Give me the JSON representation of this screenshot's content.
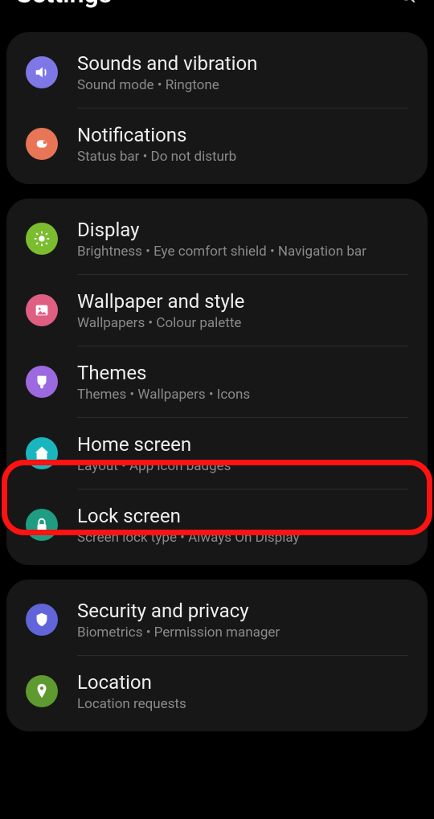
{
  "header": {
    "title": "Settings"
  },
  "groups": [
    {
      "items": [
        {
          "id": "sounds",
          "title": "Sounds and vibration",
          "subtitle": "Sound mode  •  Ringtone",
          "icon": "volume-icon",
          "color": "c-purple"
        },
        {
          "id": "notifications",
          "title": "Notifications",
          "subtitle": "Status bar  •  Do not disturb",
          "icon": "bell-icon",
          "color": "c-coral"
        }
      ]
    },
    {
      "items": [
        {
          "id": "display",
          "title": "Display",
          "subtitle": "Brightness  •  Eye comfort shield  •  Navigation bar",
          "icon": "sun-icon",
          "color": "c-green"
        },
        {
          "id": "wallpaper",
          "title": "Wallpaper and style",
          "subtitle": "Wallpapers  •  Colour palette",
          "icon": "picture-icon",
          "color": "c-pink"
        },
        {
          "id": "themes",
          "title": "Themes",
          "subtitle": "Themes  •  Wallpapers  •  Icons",
          "icon": "brush-icon",
          "color": "c-violet"
        },
        {
          "id": "home",
          "title": "Home screen",
          "subtitle": "Layout  •  App icon badges",
          "icon": "home-icon",
          "color": "c-teal"
        },
        {
          "id": "lock",
          "title": "Lock screen",
          "subtitle": "Screen lock type  •  Always On Display",
          "icon": "lock-icon",
          "color": "c-teal2"
        }
      ]
    },
    {
      "items": [
        {
          "id": "security",
          "title": "Security and privacy",
          "subtitle": "Biometrics  •  Permission manager",
          "icon": "shield-icon",
          "color": "c-indigo"
        },
        {
          "id": "location",
          "title": "Location",
          "subtitle": "Location requests",
          "icon": "location-icon",
          "color": "c-olive"
        }
      ]
    }
  ],
  "highlighted_item_id": "home"
}
